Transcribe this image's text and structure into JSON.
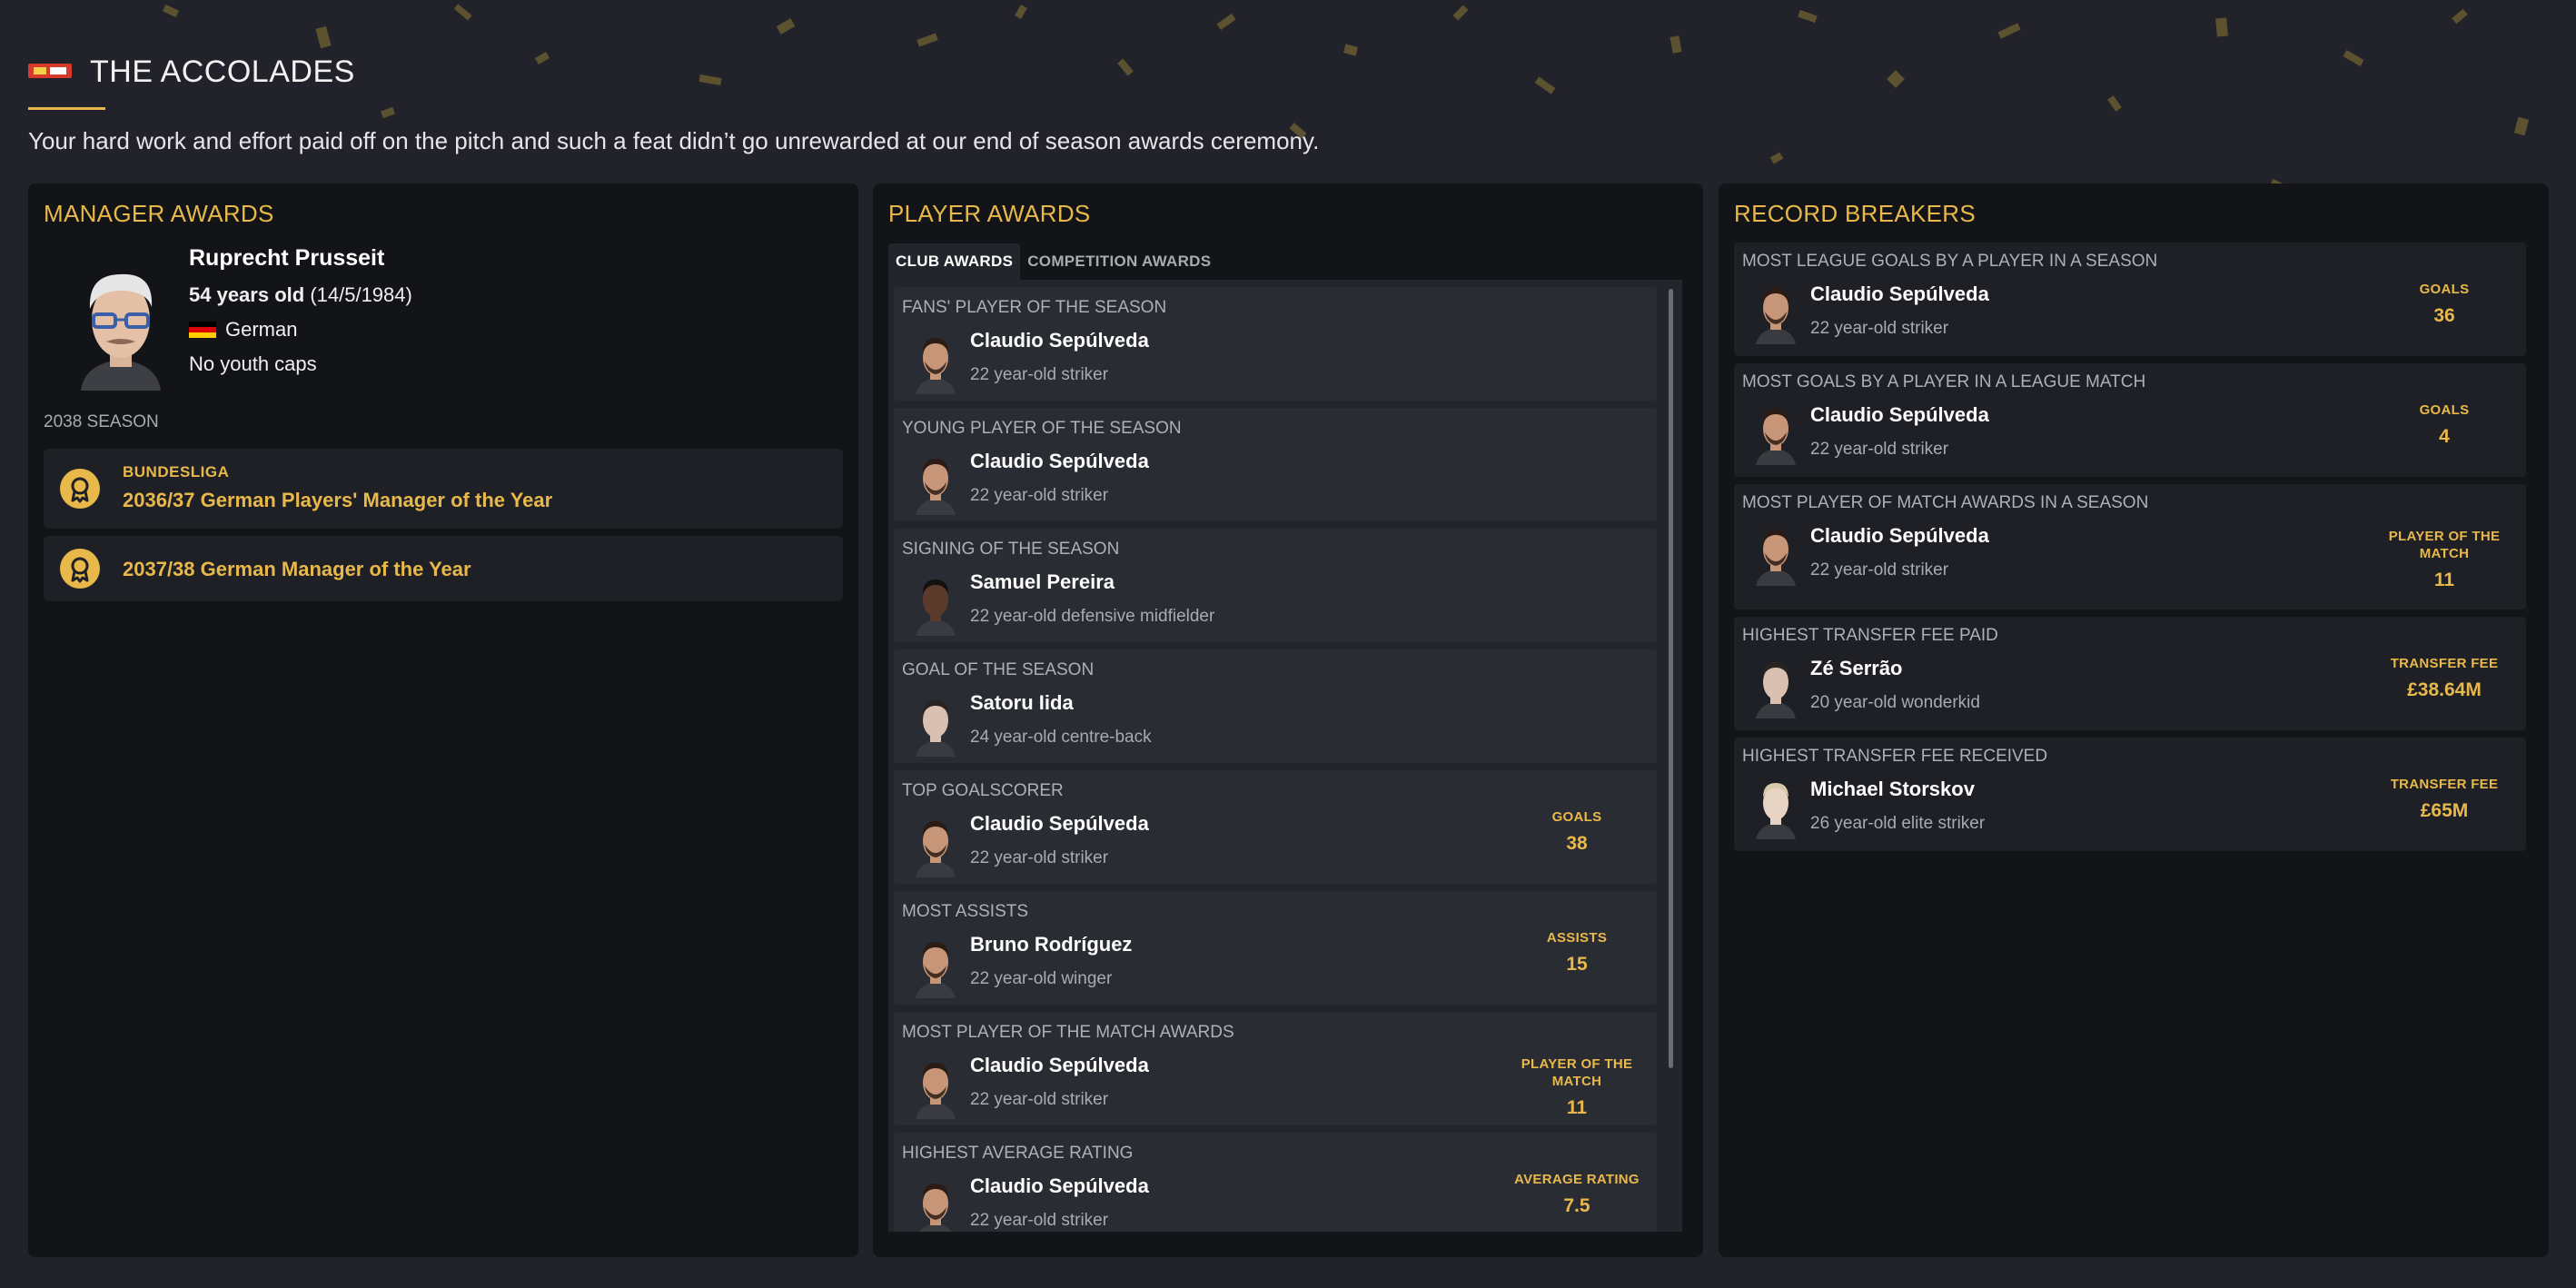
{
  "header": {
    "title": "THE ACCOLADES",
    "subtitle": "Your hard work and effort paid off on the pitch and such a feat didn’t go unrewarded at our end of season awards ceremony.",
    "club_logo": "club-crest-icon"
  },
  "manager_awards": {
    "title": "MANAGER AWARDS",
    "manager": {
      "name": "Ruprecht Prusseit",
      "age": "54 years old",
      "dob": "(14/5/1984)",
      "nationality": "German",
      "caps": "No youth caps"
    },
    "season_label": "2038 SEASON",
    "awards": [
      {
        "competition": "BUNDESLIGA",
        "name": "2036/37 German Players' Manager of the Year"
      },
      {
        "competition": "",
        "name": "2037/38 German Manager of the Year"
      }
    ]
  },
  "player_awards": {
    "title": "PLAYER AWARDS",
    "tabs": [
      "CLUB AWARDS",
      "COMPETITION AWARDS"
    ],
    "active_tab": "CLUB AWARDS",
    "cards": [
      {
        "label": "FANS' PLAYER OF THE SEASON",
        "name": "Claudio Sepúlveda",
        "desc": "22 year-old striker",
        "stat_label": "",
        "stat_value": ""
      },
      {
        "label": "YOUNG PLAYER OF THE SEASON",
        "name": "Claudio Sepúlveda",
        "desc": "22 year-old striker",
        "stat_label": "",
        "stat_value": ""
      },
      {
        "label": "SIGNING OF THE SEASON",
        "name": "Samuel Pereira",
        "desc": "22 year-old defensive midfielder",
        "stat_label": "",
        "stat_value": ""
      },
      {
        "label": "GOAL OF THE SEASON",
        "name": "Satoru Iida",
        "desc": "24 year-old centre-back",
        "stat_label": "",
        "stat_value": ""
      },
      {
        "label": "TOP GOALSCORER",
        "name": "Claudio Sepúlveda",
        "desc": "22 year-old striker",
        "stat_label": "GOALS",
        "stat_value": "38"
      },
      {
        "label": "MOST ASSISTS",
        "name": "Bruno Rodríguez",
        "desc": "22 year-old winger",
        "stat_label": "ASSISTS",
        "stat_value": "15"
      },
      {
        "label": "MOST PLAYER OF THE MATCH AWARDS",
        "name": "Claudio Sepúlveda",
        "desc": "22 year-old striker",
        "stat_label": "PLAYER OF THE MATCH",
        "stat_value": "11"
      },
      {
        "label": "HIGHEST AVERAGE RATING",
        "name": "Claudio Sepúlveda",
        "desc": "22 year-old striker",
        "stat_label": "AVERAGE RATING",
        "stat_value": "7.5"
      }
    ]
  },
  "record_breakers": {
    "title": "RECORD BREAKERS",
    "records": [
      {
        "label": "MOST LEAGUE GOALS BY A PLAYER IN A SEASON",
        "name": "Claudio Sepúlveda",
        "desc": "22 year-old striker",
        "stat_label": "GOALS",
        "stat_value": "36"
      },
      {
        "label": "MOST GOALS BY A PLAYER IN A LEAGUE MATCH",
        "name": "Claudio Sepúlveda",
        "desc": "22 year-old striker",
        "stat_label": "GOALS",
        "stat_value": "4"
      },
      {
        "label": "MOST PLAYER OF MATCH AWARDS IN A SEASON",
        "name": "Claudio Sepúlveda",
        "desc": "22 year-old striker",
        "stat_label": "PLAYER OF THE MATCH",
        "stat_value": "11"
      },
      {
        "label": "HIGHEST TRANSFER FEE PAID",
        "name": "Zé Serrão",
        "desc": "20 year-old wonderkid",
        "stat_label": "TRANSFER FEE",
        "stat_value": "£38.64M"
      },
      {
        "label": "HIGHEST TRANSFER FEE RECEIVED",
        "name": "Michael Storskov",
        "desc": "26 year-old elite striker",
        "stat_label": "TRANSFER FEE",
        "stat_value": "£65M"
      }
    ]
  },
  "colors": {
    "accent": "#e8b84a",
    "background": "#22232a",
    "panel": "#121418",
    "card": "#2a2c33"
  }
}
